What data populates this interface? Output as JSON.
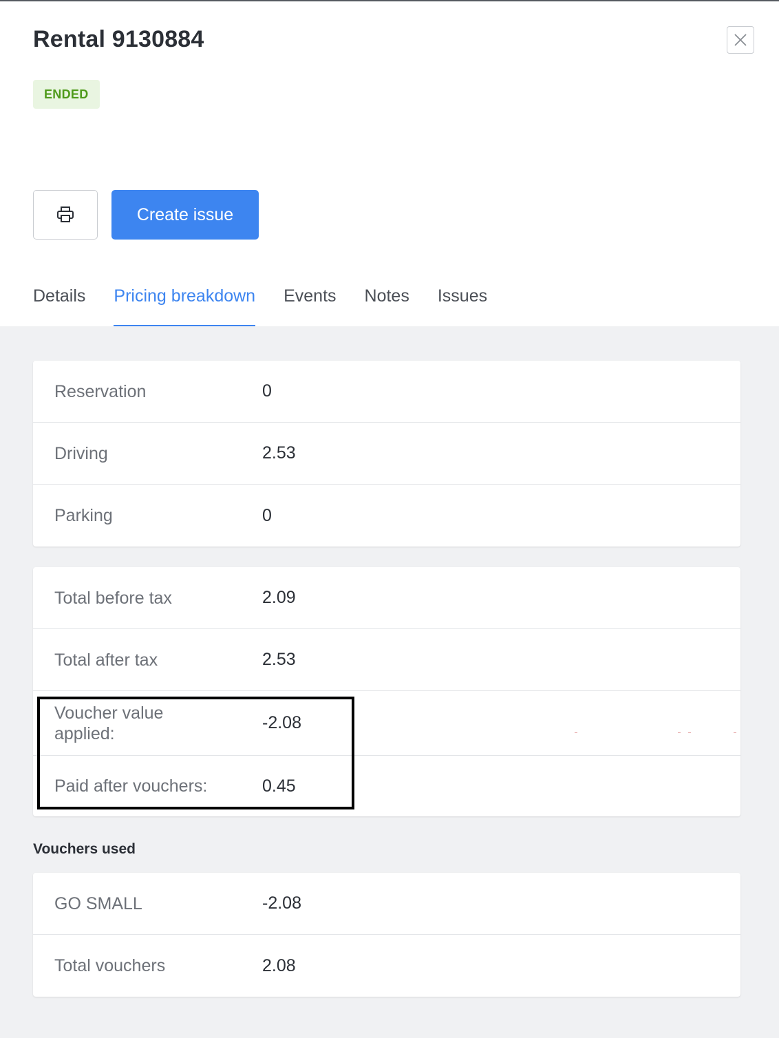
{
  "header": {
    "title": "Rental 9130884",
    "status": "ENDED",
    "close_icon": "close-icon",
    "print_icon": "printer-icon",
    "create_issue_label": "Create issue"
  },
  "tabs": [
    {
      "label": "Details",
      "active": false
    },
    {
      "label": "Pricing breakdown",
      "active": true
    },
    {
      "label": "Events",
      "active": false
    },
    {
      "label": "Notes",
      "active": false
    },
    {
      "label": "Issues",
      "active": false
    }
  ],
  "pricing": {
    "components": [
      {
        "label": "Reservation",
        "value": "0"
      },
      {
        "label": "Driving",
        "value": "2.53"
      },
      {
        "label": "Parking",
        "value": "0"
      }
    ],
    "totals": [
      {
        "label": "Total before tax",
        "value": "2.09"
      },
      {
        "label": "Total after tax",
        "value": "2.53"
      },
      {
        "label": "Voucher value applied:",
        "value": "-2.08"
      },
      {
        "label": "Paid after vouchers:",
        "value": "0.45"
      }
    ]
  },
  "vouchers": {
    "title": "Vouchers used",
    "rows": [
      {
        "label": "GO SMALL",
        "value": "-2.08"
      },
      {
        "label": "Total vouchers",
        "value": "2.08"
      }
    ]
  },
  "colors": {
    "accent": "#3d85f0",
    "status_bg": "#e9f5e1",
    "status_text": "#4e9a1a",
    "content_bg": "#f0f1f3"
  }
}
